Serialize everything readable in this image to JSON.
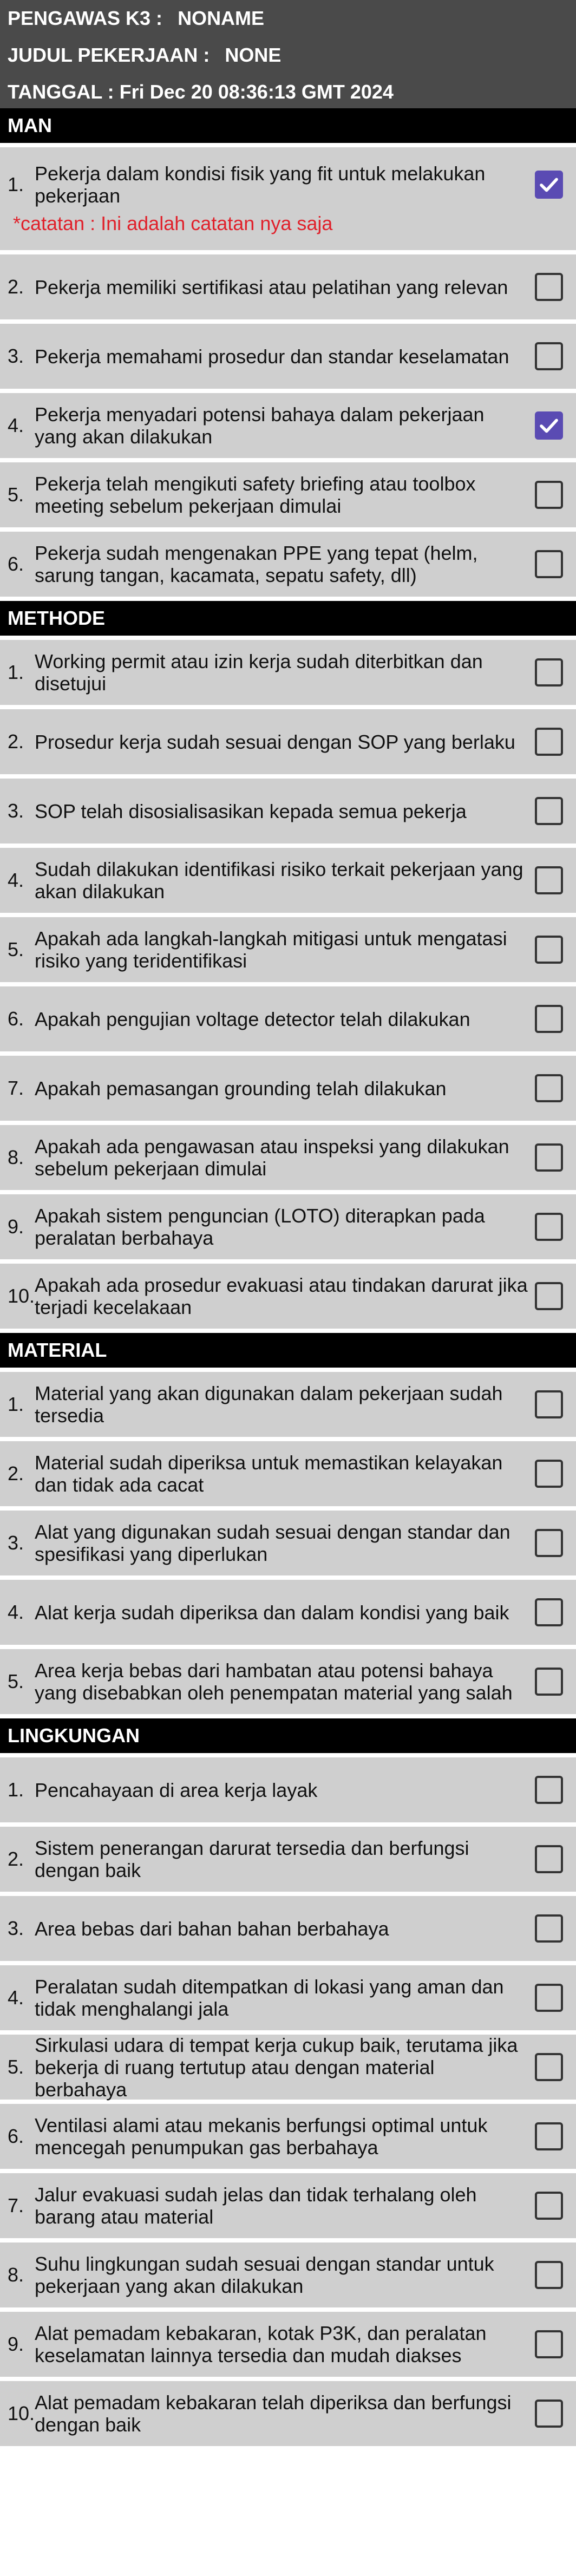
{
  "header": {
    "pengawas_label": "PENGAWAS K3 :",
    "pengawas_value": "NONAME",
    "judul_label": "JUDUL PEKERJAAN :",
    "judul_value": "NONE",
    "tanggal_label": "TANGGAL :",
    "tanggal_value": "Fri Dec 20 08:36:13 GMT 2024"
  },
  "sections": {
    "man": {
      "title": "MAN",
      "items": [
        {
          "num": "1.",
          "text": "Pekerja dalam kondisi fisik yang fit untuk melakukan pekerjaan",
          "checked": true,
          "note": "*catatan : Ini adalah catatan nya saja"
        },
        {
          "num": "2.",
          "text": "Pekerja memiliki sertifikasi atau pelatihan yang relevan",
          "checked": false
        },
        {
          "num": "3.",
          "text": "Pekerja memahami prosedur dan standar keselamatan",
          "checked": false
        },
        {
          "num": "4.",
          "text": "Pekerja menyadari potensi bahaya dalam pekerjaan yang akan dilakukan",
          "checked": true
        },
        {
          "num": "5.",
          "text": "Pekerja telah mengikuti safety briefing atau toolbox meeting sebelum pekerjaan dimulai",
          "checked": false
        },
        {
          "num": "6.",
          "text": "Pekerja sudah mengenakan PPE yang tepat (helm, sarung tangan, kacamata, sepatu safety, dll)",
          "checked": false
        }
      ]
    },
    "methode": {
      "title": "METHODE",
      "items": [
        {
          "num": "1.",
          "text": "Working permit atau izin kerja sudah diterbitkan dan disetujui",
          "checked": false
        },
        {
          "num": "2.",
          "text": "Prosedur kerja sudah sesuai dengan SOP yang berlaku",
          "checked": false
        },
        {
          "num": "3.",
          "text": "SOP telah disosialisasikan kepada semua pekerja",
          "checked": false
        },
        {
          "num": "4.",
          "text": "Sudah dilakukan identifikasi risiko terkait pekerjaan yang akan dilakukan",
          "checked": false
        },
        {
          "num": "5.",
          "text": "Apakah ada langkah-langkah mitigasi untuk mengatasi risiko yang teridentifikasi",
          "checked": false
        },
        {
          "num": "6.",
          "text": "Apakah pengujian voltage detector telah dilakukan",
          "checked": false
        },
        {
          "num": "7.",
          "text": "Apakah pemasangan grounding telah dilakukan",
          "checked": false
        },
        {
          "num": "8.",
          "text": "Apakah ada pengawasan atau inspeksi yang dilakukan sebelum pekerjaan dimulai",
          "checked": false
        },
        {
          "num": "9.",
          "text": "Apakah sistem penguncian (LOTO) diterapkan pada peralatan berbahaya",
          "checked": false
        },
        {
          "num": "10.",
          "text": "Apakah ada prosedur evakuasi atau tindakan darurat jika terjadi kecelakaan",
          "checked": false
        }
      ]
    },
    "material": {
      "title": "MATERIAL",
      "items": [
        {
          "num": "1.",
          "text": "Material yang akan digunakan dalam pekerjaan sudah tersedia",
          "checked": false
        },
        {
          "num": "2.",
          "text": "Material sudah diperiksa untuk memastikan kelayakan dan tidak ada cacat",
          "checked": false
        },
        {
          "num": "3.",
          "text": "Alat yang digunakan sudah sesuai dengan standar dan spesifikasi yang diperlukan",
          "checked": false
        },
        {
          "num": "4.",
          "text": "Alat kerja sudah diperiksa dan dalam kondisi yang baik",
          "checked": false
        },
        {
          "num": "5.",
          "text": "Area kerja bebas dari hambatan atau potensi bahaya yang disebabkan oleh penempatan material yang salah",
          "checked": false
        }
      ]
    },
    "lingkungan": {
      "title": "LINGKUNGAN",
      "items": [
        {
          "num": "1.",
          "text": "Pencahayaan di area kerja layak",
          "checked": false
        },
        {
          "num": "2.",
          "text": "Sistem penerangan darurat tersedia dan berfungsi dengan baik",
          "checked": false
        },
        {
          "num": "3.",
          "text": "Area bebas dari bahan bahan berbahaya",
          "checked": false
        },
        {
          "num": "4.",
          "text": "Peralatan sudah ditempatkan di lokasi yang aman dan tidak menghalangi jala",
          "checked": false
        },
        {
          "num": "5.",
          "text": "Sirkulasi udara di tempat kerja cukup baik, terutama jika bekerja di ruang tertutup atau dengan material berbahaya",
          "checked": false
        },
        {
          "num": "6.",
          "text": "Ventilasi alami atau mekanis berfungsi optimal untuk mencegah penumpukan gas berbahaya",
          "checked": false
        },
        {
          "num": "7.",
          "text": "Jalur evakuasi sudah jelas dan tidak terhalang oleh barang atau material",
          "checked": false
        },
        {
          "num": "8.",
          "text": "Suhu lingkungan sudah sesuai dengan standar untuk pekerjaan yang akan dilakukan",
          "checked": false
        },
        {
          "num": "9.",
          "text": "Alat pemadam kebakaran, kotak P3K, dan peralatan keselamatan lainnya tersedia dan mudah diakses",
          "checked": false
        },
        {
          "num": "10.",
          "text": "Alat pemadam kebakaran telah diperiksa dan berfungsi dengan baik",
          "checked": false
        }
      ]
    }
  },
  "colors": {
    "header_bg": "#4a4a4a",
    "section_bg": "#000000",
    "item_bg": "#cfcfcf",
    "checked": "#5a4bb3",
    "note": "#e0212b"
  }
}
